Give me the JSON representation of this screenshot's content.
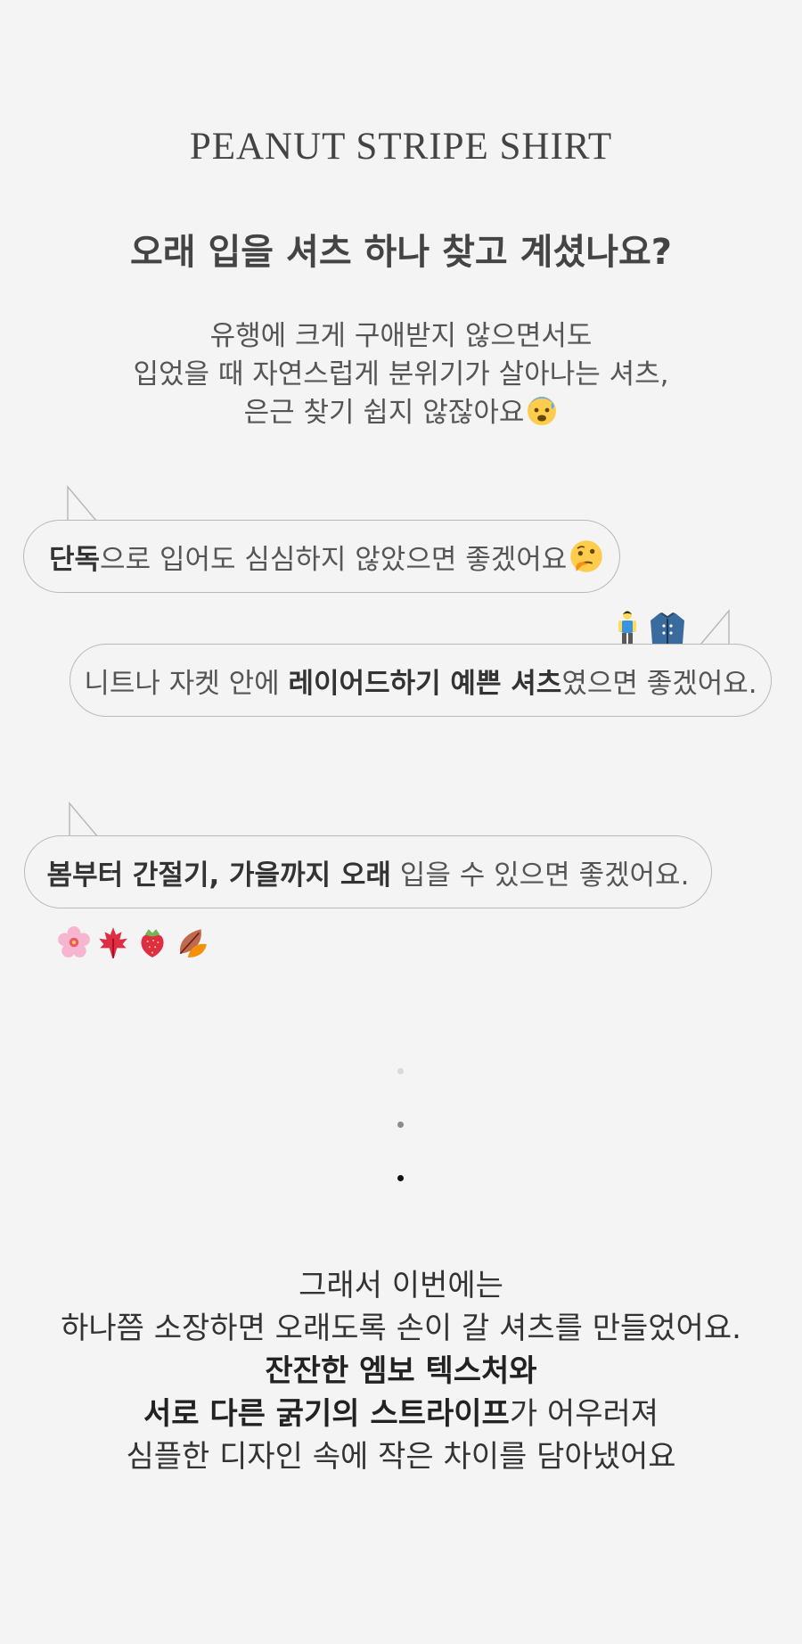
{
  "header": {
    "title": "PEANUT STRIPE SHIRT",
    "headline": "오래 입을 셔츠 하나 찾고 계셨나요?"
  },
  "intro": {
    "line1": "유행에 크게 구애받지 않으면서도",
    "line2": "입었을 때 자연스럽게 분위기가 살아나는 셔츠,",
    "line3": "은근 찾기 쉽지 않잖아요"
  },
  "bubbles": [
    {
      "bold": "단독",
      "rest": "으로 입어도 심심하지 않았으면 좋겠어요"
    },
    {
      "pre": "니트나 자켓 안에 ",
      "bold": "레이어드하기 예쁜 셔츠",
      "rest": "였으면 좋겠어요."
    },
    {
      "bold": "봄부터 간절기, 가을까지 오래",
      "rest": " 입을 수 있으면 좋겠어요."
    }
  ],
  "emojis": {
    "intro": "anxious-sweat-face-icon",
    "bubble1": "thinking-face-icon",
    "bubble2": [
      "man-standing-icon",
      "coat-jacket-icon"
    ],
    "seasons": [
      "cherry-blossom-icon",
      "maple-leaf-icon",
      "strawberry-icon",
      "fallen-leaves-icon"
    ]
  },
  "outro": {
    "line1": "그래서 이번에는",
    "line2": "하나쯤 소장하면 오래도록 손이 갈 셔츠를 만들었어요.",
    "line3_bold": "잔잔한 엠보 텍스처와",
    "line4_bold": "서로 다른 굵기의 스트라이프",
    "line4_rest": "가 어우러져",
    "line5": "심플한 디자인 속에 작은 차이를 담아냈어요"
  },
  "colors": {
    "background": "#f4f4f4",
    "bubble_border": "#b9b9b9",
    "text": "#333333"
  }
}
